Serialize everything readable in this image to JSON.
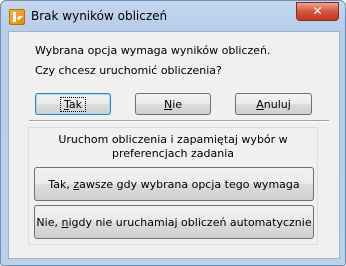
{
  "window": {
    "title": "Brak wyników obliczeń"
  },
  "message": {
    "line1": "Wybrana opcja wymaga wyników obliczeń.",
    "line2": "Czy chcesz uruchomić obliczenia?"
  },
  "buttons": {
    "yes": {
      "pre": "",
      "key": "T",
      "post": "ak"
    },
    "no": {
      "pre": "",
      "key": "N",
      "post": "ie"
    },
    "cancel": {
      "pre": "",
      "key": "A",
      "post": "nuluj"
    }
  },
  "remember_group": {
    "title": "Uruchom obliczenia i zapamiętaj wybór w preferencjach zadania",
    "always": {
      "pre": "Tak, ",
      "key": "z",
      "post": "awsze gdy wybrana opcja tego wymaga"
    },
    "never": {
      "pre": "Nie, ",
      "key": "n",
      "post": "igdy nie uruchamiaj obliczeń automatycznie"
    }
  },
  "colors": {
    "title_bar": "#c3d6ee",
    "close_button": "#c0391f",
    "dialog_background": "#f0f0f0",
    "default_button_border": "#3c7fb1"
  }
}
